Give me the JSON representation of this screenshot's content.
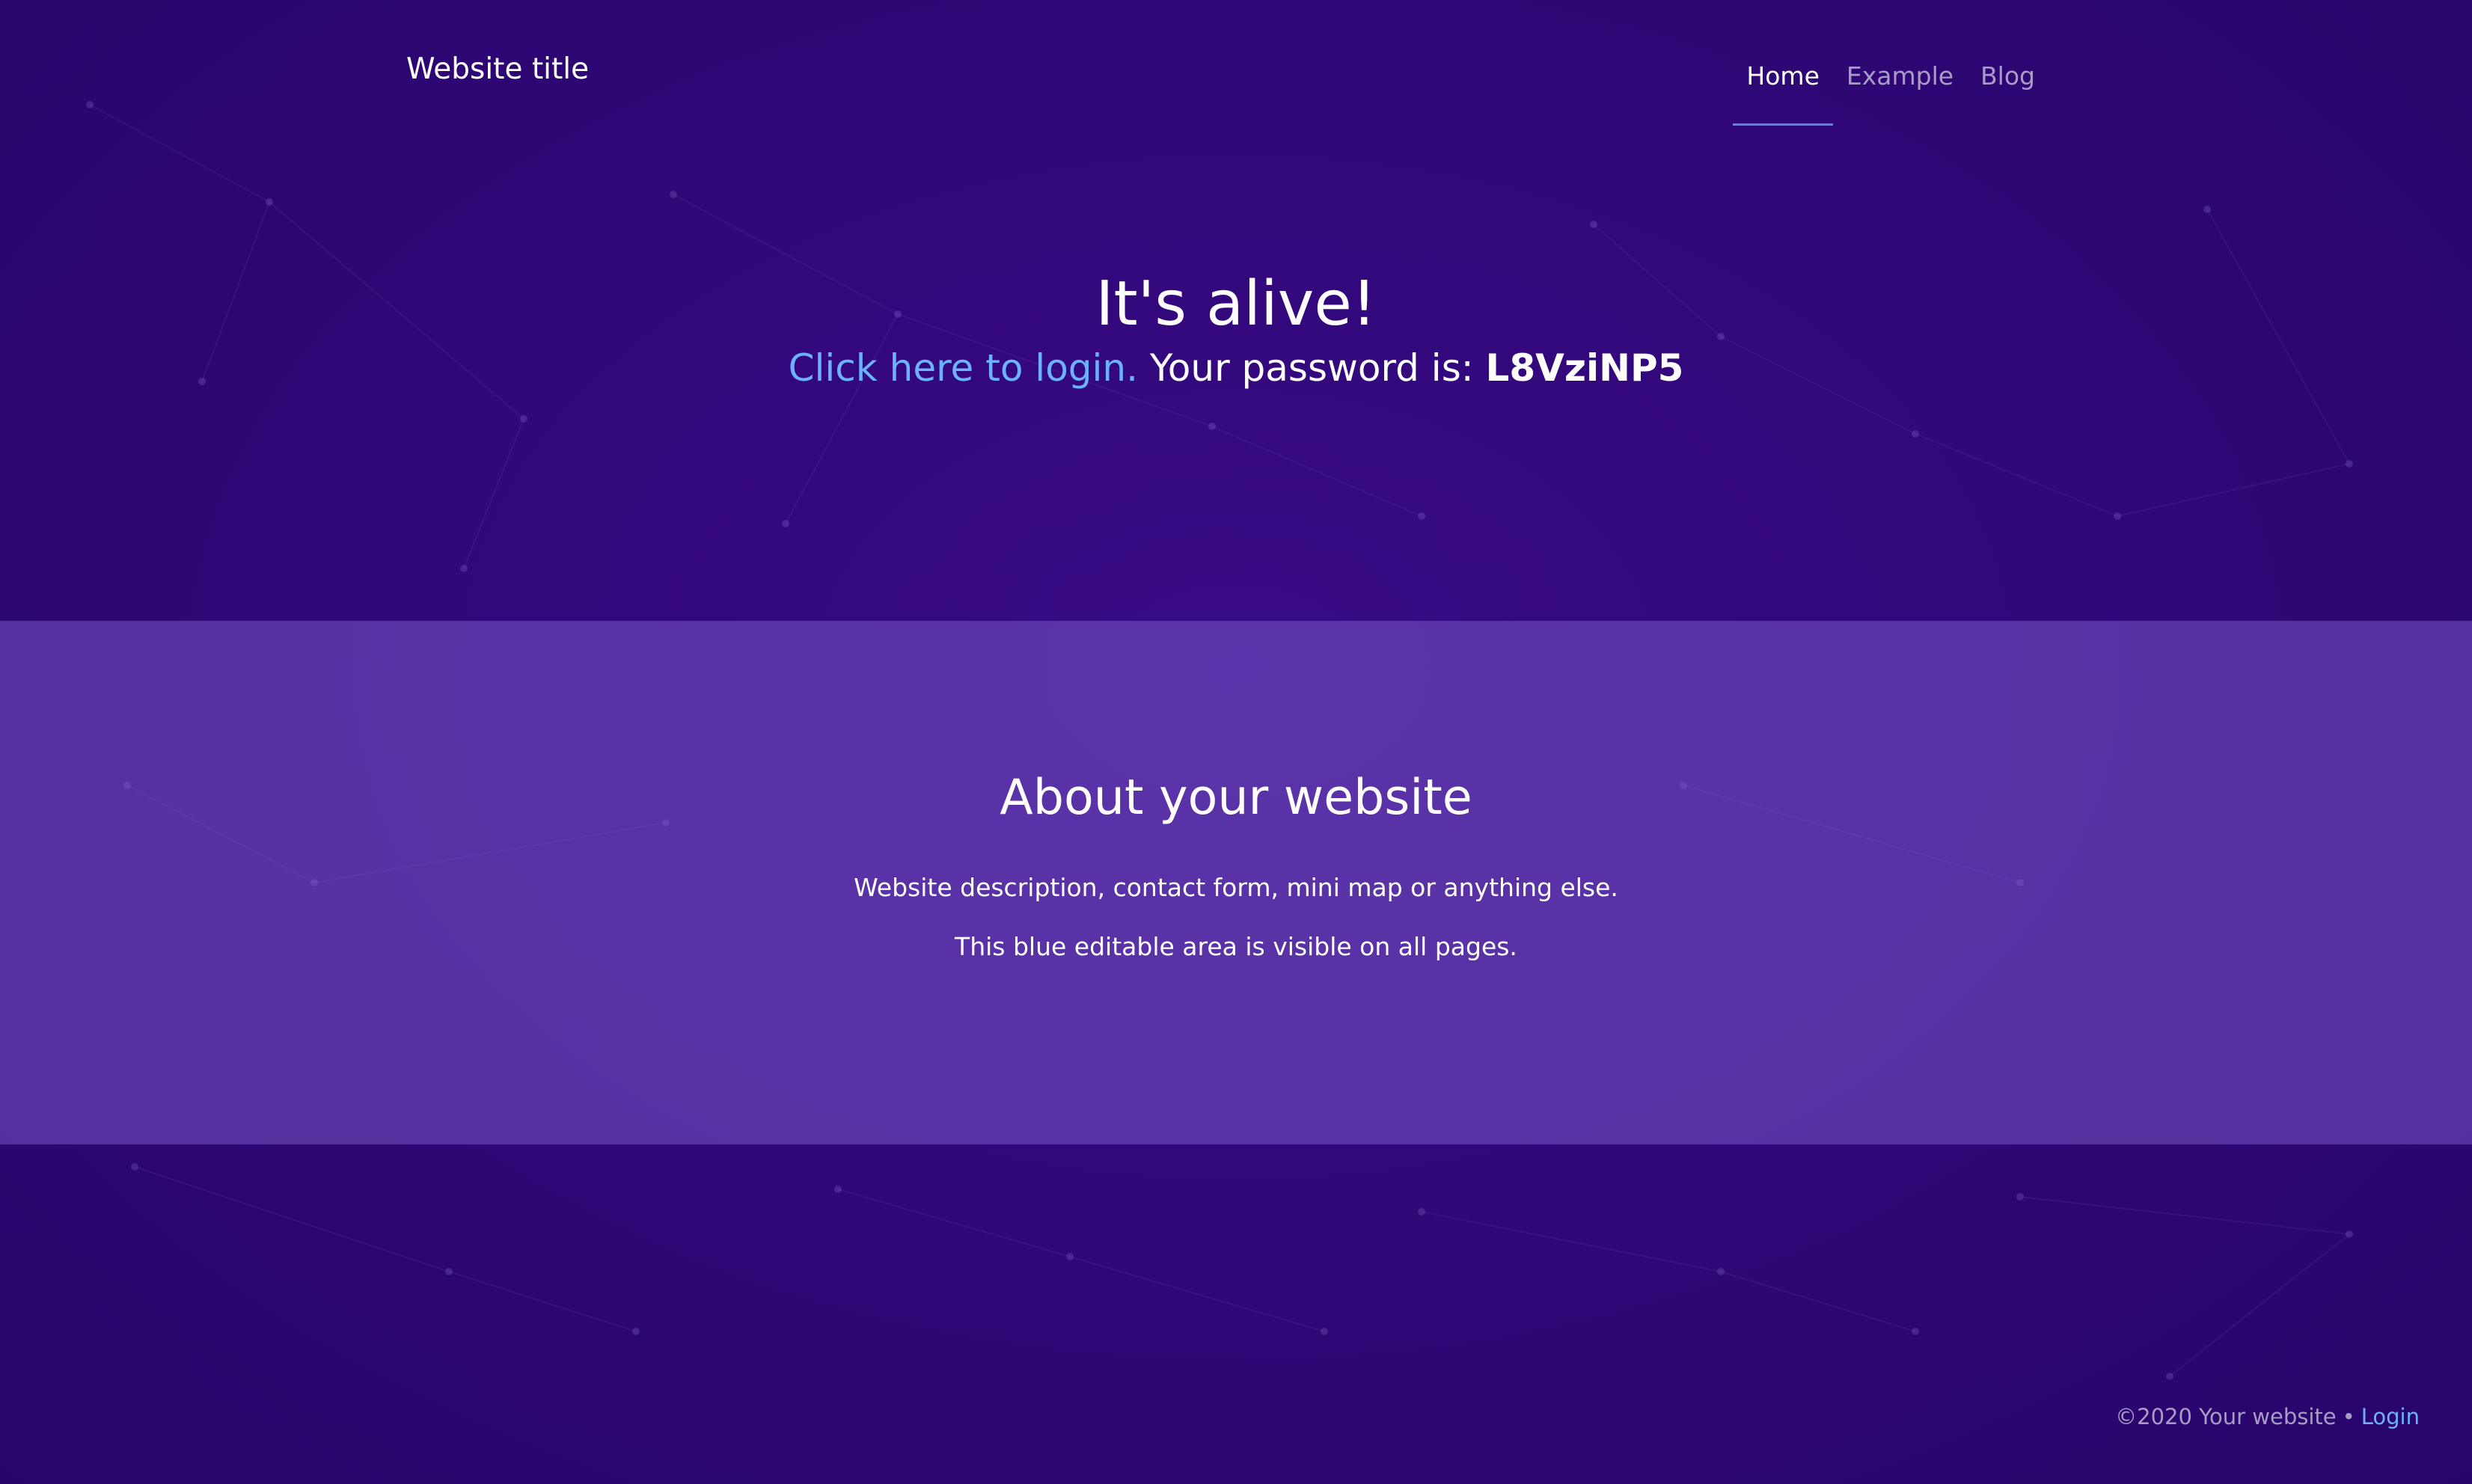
{
  "site": {
    "title": "Website title"
  },
  "nav": {
    "items": [
      {
        "label": "Home"
      },
      {
        "label": "Example"
      },
      {
        "label": "Blog"
      }
    ]
  },
  "hero": {
    "heading": "It's alive!",
    "login_link": "Click here to login.",
    "password_label": "Your password is:",
    "password_value": "L8VziNP5"
  },
  "about": {
    "heading": "About your website",
    "paragraphs": [
      "Website description, contact form, mini map or anything else.",
      "This blue editable area is visible on all pages."
    ]
  },
  "footer": {
    "copyright": "©2020 Your website",
    "separator": "•",
    "login": "Login"
  },
  "colors": {
    "background": "#34077f",
    "about_band": "#5432a0",
    "link": "#6cb2ff",
    "nav_inactive": "#a79cc6",
    "nav_underline": "#5b84e6"
  }
}
